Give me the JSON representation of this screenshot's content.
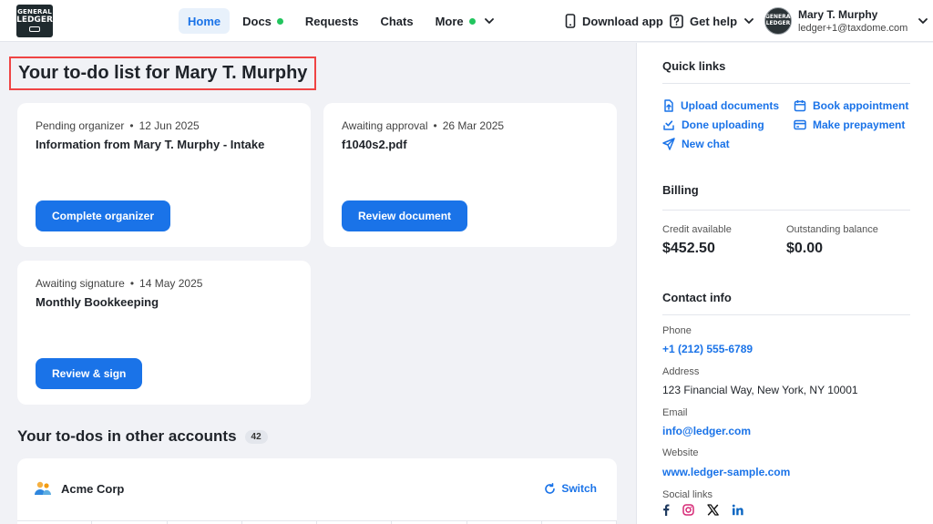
{
  "brand": {
    "logo_line1": "GENERAL",
    "logo_line2": "LEDGER"
  },
  "nav": {
    "items": [
      {
        "label": "Home",
        "active": true,
        "dot": false
      },
      {
        "label": "Docs",
        "active": false,
        "dot": true
      },
      {
        "label": "Requests",
        "active": false,
        "dot": false
      },
      {
        "label": "Chats",
        "active": false,
        "dot": false
      },
      {
        "label": "More",
        "active": false,
        "dot": true
      }
    ]
  },
  "header": {
    "download_label": "Download app",
    "help_label": "Get help",
    "user_name": "Mary T. Murphy",
    "user_email": "ledger+1@taxdome.com"
  },
  "main": {
    "title": "Your to-do list for Mary T. Murphy",
    "todos": [
      {
        "status": "Pending organizer",
        "date": "12 Jun 2025",
        "name": "Information from Mary T. Murphy - Intake",
        "action": "Complete organizer"
      },
      {
        "status": "Awaiting approval",
        "date": "26 Mar 2025",
        "name": "f1040s2.pdf",
        "action": "Review document"
      },
      {
        "status": "Awaiting signature",
        "date": "14 May 2025",
        "name": "Monthly Bookkeeping",
        "action": "Review & sign"
      }
    ],
    "other_title": "Your to-dos in other accounts",
    "other_count": "42",
    "account_name": "Acme Corp",
    "switch_label": "Switch"
  },
  "sidebar": {
    "quick_links_title": "Quick links",
    "quick_links": {
      "upload": "Upload documents",
      "book": "Book appointment",
      "done": "Done uploading",
      "prepay": "Make prepayment",
      "chat": "New chat"
    },
    "billing_title": "Billing",
    "credit_label": "Credit available",
    "credit_value": "$452.50",
    "outstanding_label": "Outstanding balance",
    "outstanding_value": "$0.00",
    "contact_title": "Contact info",
    "phone_label": "Phone",
    "phone_value": "+1 (212) 555-6789",
    "address_label": "Address",
    "address_value": "123 Financial Way, New York, NY 10001",
    "email_label": "Email",
    "email_value": "info@ledger.com",
    "website_label": "Website",
    "website_value": "www.ledger-sample.com",
    "social_label": "Social links",
    "socials": [
      "facebook-icon",
      "instagram-icon",
      "x-icon",
      "linkedin-icon"
    ]
  },
  "colors": {
    "accent": "#1a73e8",
    "dot": "#22c55e",
    "highlight": "#ef4444"
  }
}
